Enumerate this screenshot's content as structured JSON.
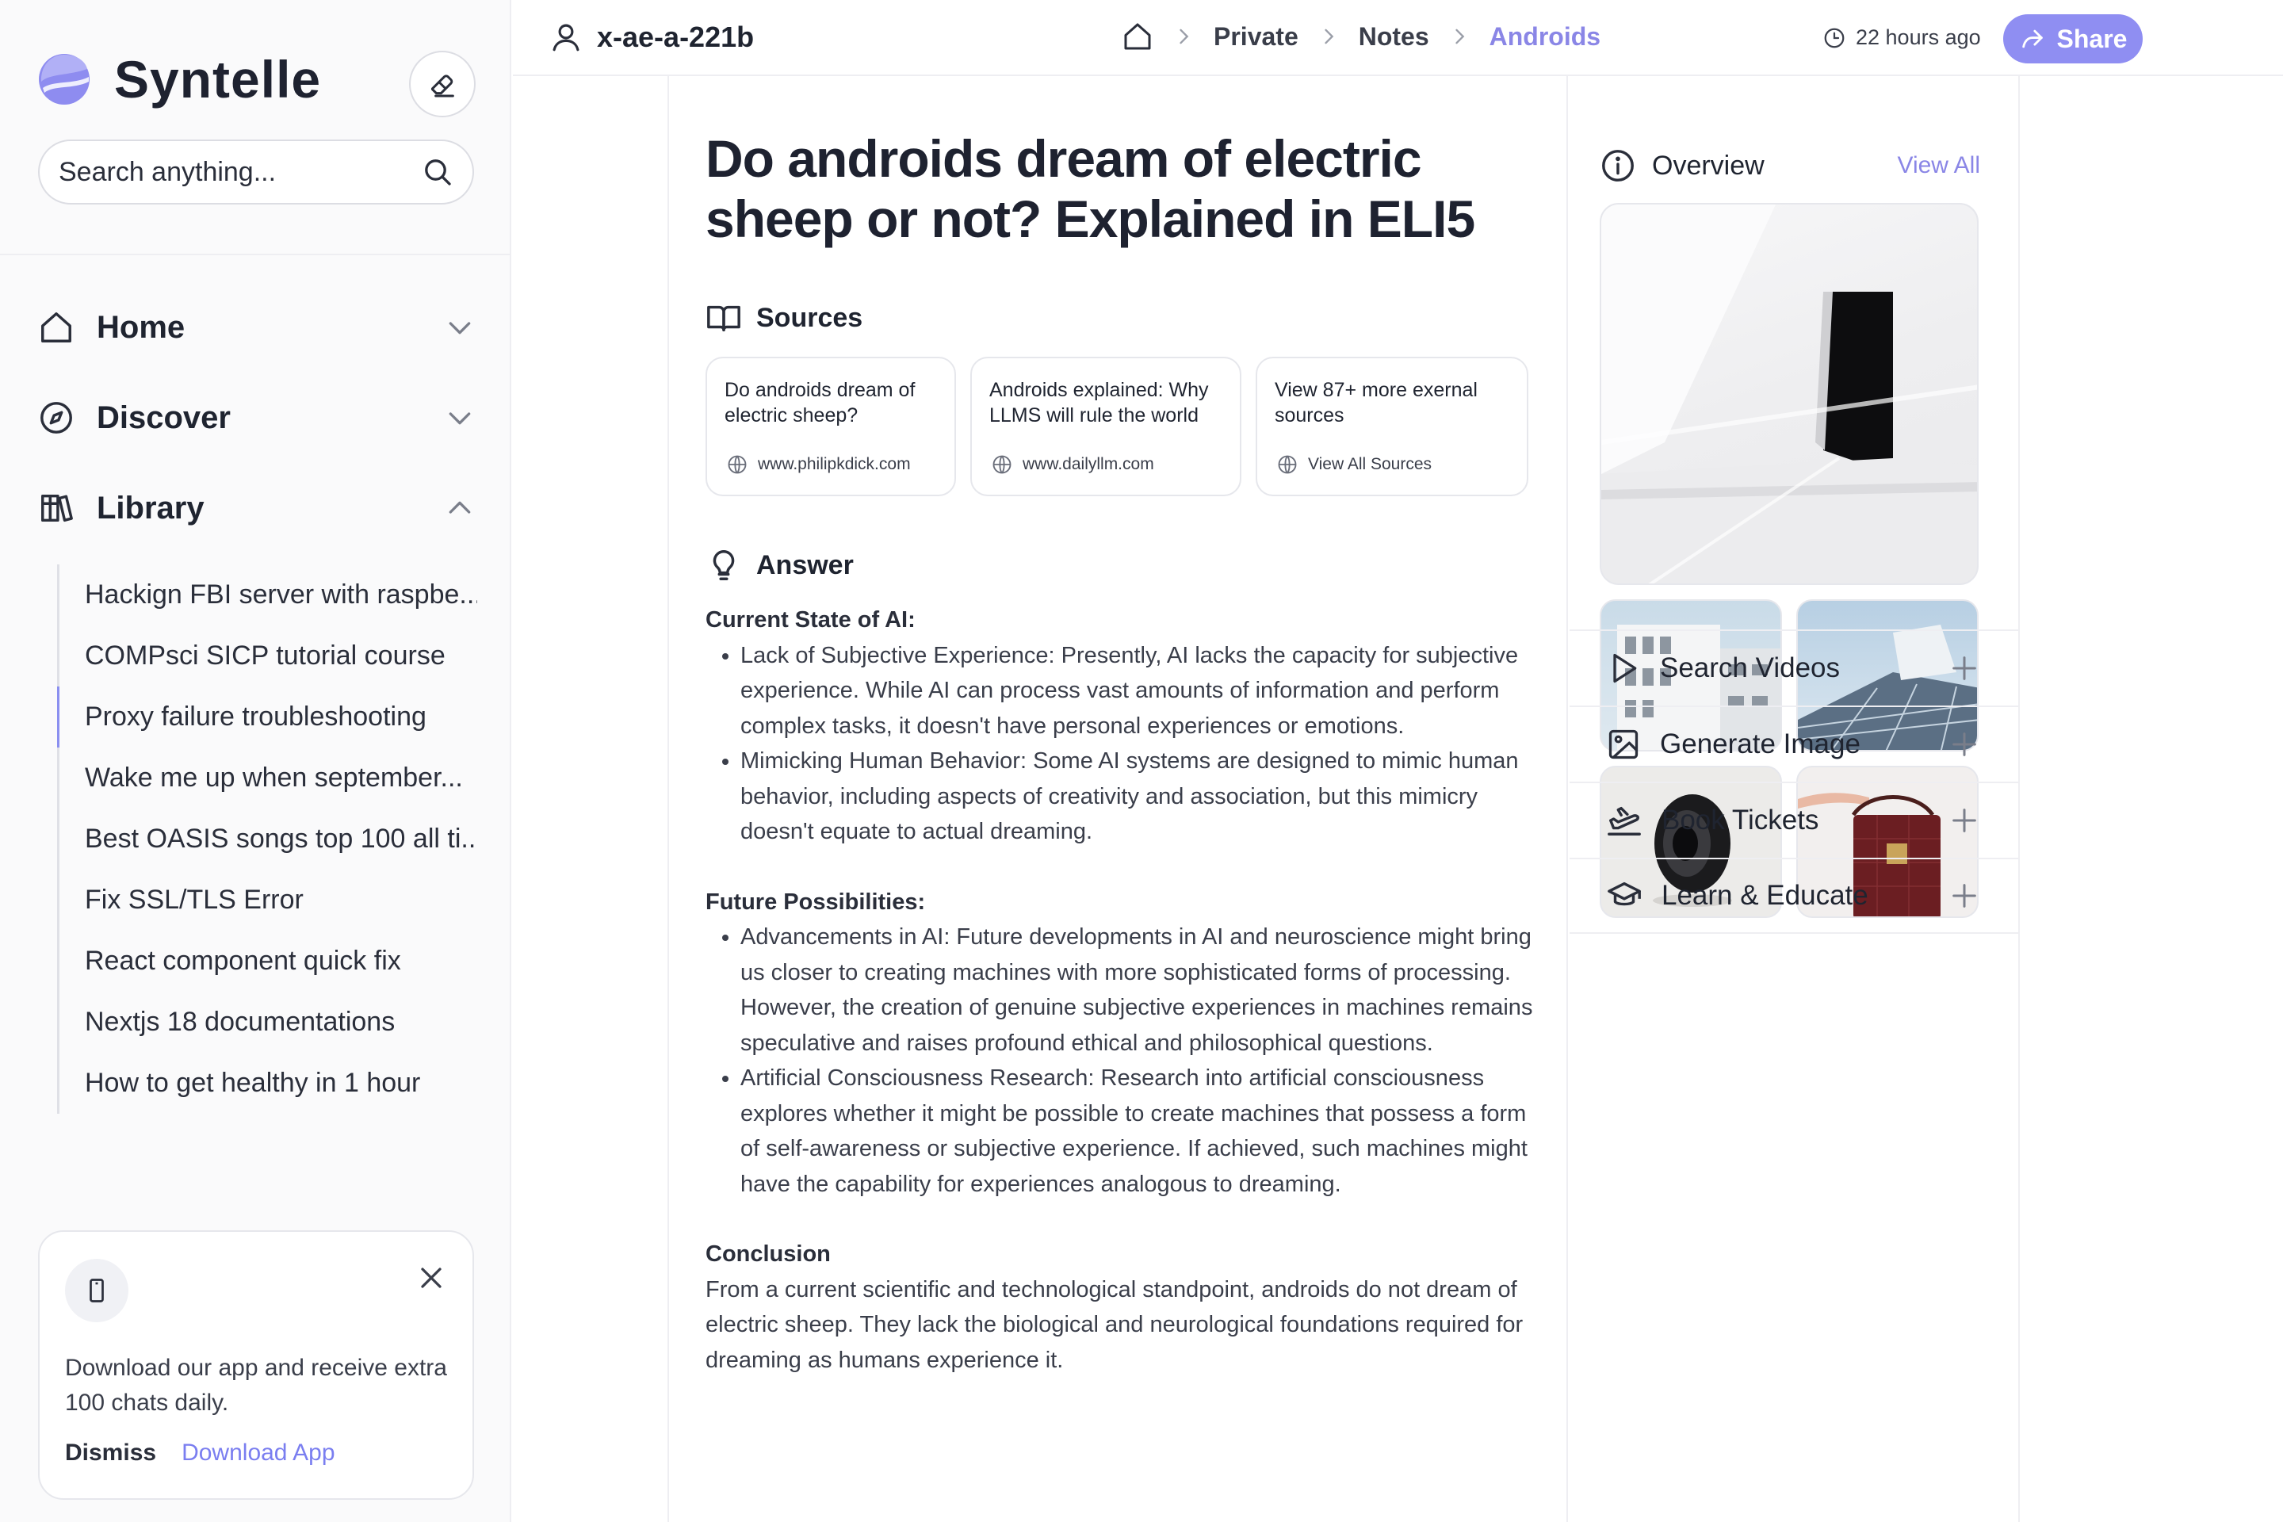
{
  "sidebar": {
    "brand": "Syntelle",
    "search_placeholder": "Search anything...",
    "nav": [
      {
        "label": "Home"
      },
      {
        "label": "Discover"
      },
      {
        "label": "Library"
      }
    ],
    "library_items": [
      "Hackign FBI server with raspbe...",
      "COMPsci SICP tutorial course",
      "Proxy failure troubleshooting",
      "Wake me up when september...",
      "Best OASIS songs top 100 all ti...",
      "Fix SSL/TLS Error",
      "React component quick fix",
      "Nextjs 18 documentations",
      "How to get healthy in 1 hour"
    ],
    "promo": {
      "text": "Download our app and receive extra 100 chats daily.",
      "dismiss": "Dismiss",
      "download": "Download App"
    }
  },
  "header": {
    "username": "x-ae-a-221b",
    "breadcrumbs": [
      "Private",
      "Notes",
      "Androids"
    ],
    "time": "22 hours ago",
    "share": "Share"
  },
  "main": {
    "title": "Do androids dream of electric sheep or not? Explained in ELI5",
    "sources_label": "Sources",
    "sources": [
      {
        "title": "Do androids dream of electric sheep?",
        "link": "www.philipkdick.com"
      },
      {
        "title": "Androids explained: Why LLMS will rule the world",
        "link": "www.dailyllm.com"
      },
      {
        "title": "View 87+ more exernal sources",
        "link": "View All Sources"
      }
    ],
    "answer_label": "Answer",
    "answer": {
      "s1_title": "Current State of AI:",
      "s1_items": [
        "Lack of Subjective Experience: Presently, AI lacks the capacity for subjective experience. While AI can process vast amounts of information and perform complex tasks, it doesn't have personal experiences or emotions.",
        "Mimicking Human Behavior: Some AI systems are designed to mimic human behavior, including aspects of creativity and association, but this mimicry doesn't equate to actual dreaming."
      ],
      "s2_title": "Future Possibilities:",
      "s2_items": [
        "Advancements in AI: Future developments in AI and neuroscience might bring us closer to creating machines with more sophisticated forms of processing. However, the creation of genuine subjective experiences in machines remains speculative and raises profound ethical and philosophical questions.",
        "Artificial Consciousness Research: Research into artificial consciousness explores whether it might be possible to create machines that possess a form of self-awareness or subjective experience. If achieved, such machines might have the capability for experiences analogous to dreaming."
      ],
      "s3_title": "Conclusion",
      "s3_text": "From a current scientific and technological standpoint, androids do not dream of electric sheep. They lack the biological and neurological foundations required for dreaming as humans experience it."
    }
  },
  "right": {
    "overview": "Overview",
    "view_all": "View All",
    "tools": [
      "Search Videos",
      "Generate Image",
      "Book Tickets",
      "Learn & Educate"
    ]
  },
  "colors": {
    "accent": "#8f8ef2",
    "accent_text": "#8a86e6",
    "text": "#1f2430"
  }
}
